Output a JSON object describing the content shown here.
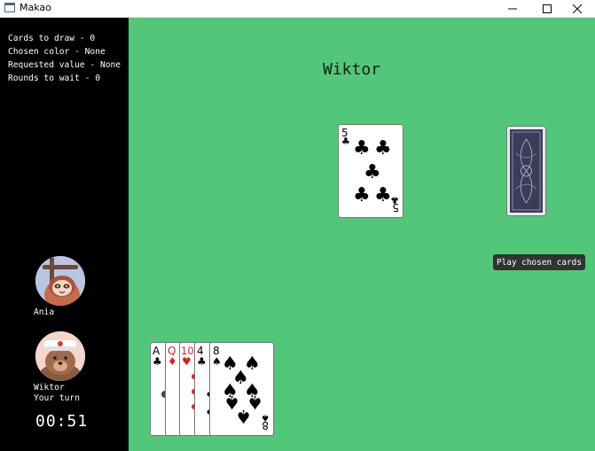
{
  "window": {
    "title": "Makao"
  },
  "stats": {
    "cards_to_draw": "Cards to draw - 0",
    "chosen_color": "Chosen color - None",
    "requested_value": "Requested value - None",
    "rounds_to_wait": "Rounds to wait - 0"
  },
  "players": [
    {
      "name": "Ania",
      "avatar": "sloth-avatar",
      "status": ""
    },
    {
      "name": "Wiktor",
      "avatar": "bear-avatar",
      "status": "Your turn"
    }
  ],
  "timer": "00:51",
  "table": {
    "current_player": "Wiktor",
    "top_card": {
      "rank": "5",
      "suit": "clubs"
    },
    "deck": {
      "face": "down"
    },
    "play_button_label": "Play chosen cards"
  },
  "hand": [
    {
      "rank": "A",
      "suit": "clubs",
      "color": "#000000"
    },
    {
      "rank": "Q",
      "suit": "diamonds",
      "color": "#e0201e"
    },
    {
      "rank": "10",
      "suit": "hearts",
      "color": "#e0201e"
    },
    {
      "rank": "4",
      "suit": "clubs",
      "color": "#000000"
    },
    {
      "rank": "8",
      "suit": "spades",
      "color": "#000000"
    }
  ]
}
